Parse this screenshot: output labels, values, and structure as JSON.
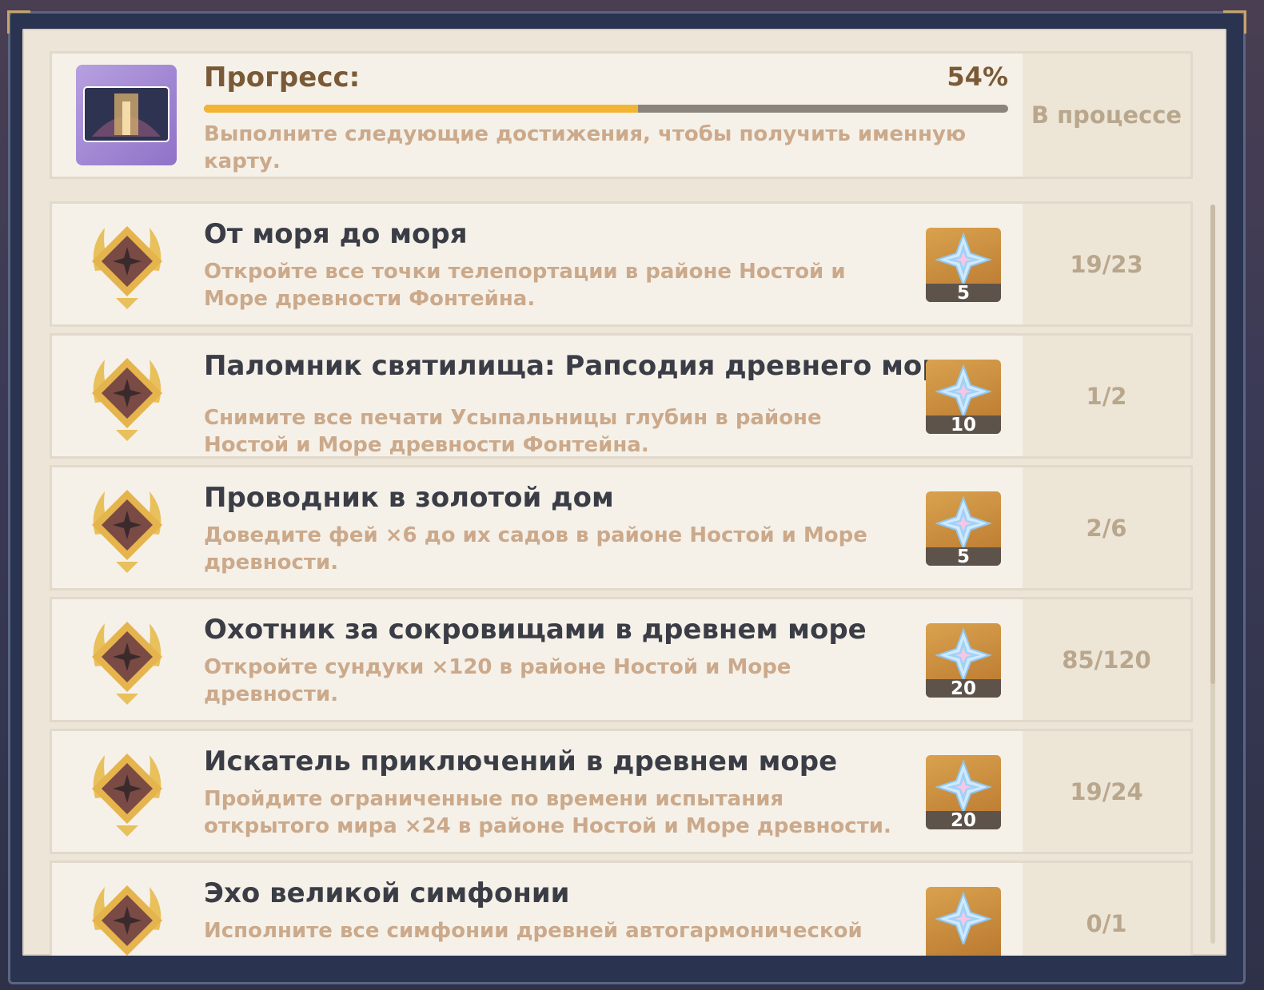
{
  "header": {
    "progress_label": "Прогресс:",
    "percent_text": "54%",
    "progress_fraction": 0.54,
    "description": "Выполните следующие достижения, чтобы получить именную карту.",
    "status": "В процессе"
  },
  "achievements": [
    {
      "title": "От моря до моря",
      "description": "Откройте все точки телепортации в районе Ностой и Море древности Фонтейна.",
      "reward": "5",
      "progress": "19/23"
    },
    {
      "title": "Паломник святилища: Рапсодия древнего моря",
      "description": "Снимите все печати Усыпальницы глубин в районе Ностой и Море древности Фонтейна.",
      "reward": "10",
      "progress": "1/2"
    },
    {
      "title": "Проводник в золотой дом",
      "description": "Доведите фей ×6 до их садов в районе Ностой и Море древности.",
      "reward": "5",
      "progress": "2/6"
    },
    {
      "title": "Охотник за сокровищами в древнем море",
      "description": "Откройте сундуки ×120 в районе Ностой и Море древности.",
      "reward": "20",
      "progress": "85/120"
    },
    {
      "title": "Искатель приключений в древнем море",
      "description": "Пройдите ограниченные по времени испытания открытого мира ×24 в районе Ностой и Море древности.",
      "reward": "20",
      "progress": "19/24"
    },
    {
      "title": "Эхо великой симфонии",
      "description": "Исполните все симфонии древней автогармонической",
      "reward": "",
      "progress": "0/1"
    }
  ],
  "colors": {
    "accent": "#f2b533",
    "title": "#3b3d46",
    "desc": "#cba98a",
    "status": "#b9a78d"
  },
  "icons": {
    "header": "namecard-icon",
    "medal": "achievement-medal-icon",
    "reward": "primogem-icon"
  }
}
